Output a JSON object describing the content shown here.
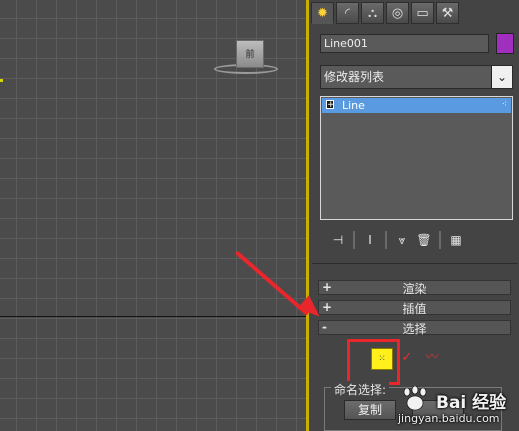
{
  "viewport": {
    "viewcube_label": "前",
    "border_color": "#c8b000"
  },
  "tabs": [
    {
      "name": "create-tab",
      "icon": "sun-icon",
      "glyph": "✹"
    },
    {
      "name": "modify-tab",
      "icon": "modify-arc-icon",
      "glyph": "◜"
    },
    {
      "name": "hierarchy-tab",
      "icon": "hierarchy-icon",
      "glyph": "⛬"
    },
    {
      "name": "motion-tab",
      "icon": "motion-icon",
      "glyph": "◎"
    },
    {
      "name": "display-tab",
      "icon": "monitor-icon",
      "glyph": "▭"
    },
    {
      "name": "utilities-tab",
      "icon": "hammer-icon",
      "glyph": "⚒"
    }
  ],
  "object": {
    "name": "Line001",
    "color": "#a02ebe"
  },
  "modifier_list": {
    "selected": "修改器列表"
  },
  "stack": {
    "items": [
      {
        "label": "Line",
        "expand": "+"
      }
    ]
  },
  "stack_tools": [
    {
      "name": "pin-stack-icon",
      "glyph": "⊣"
    },
    {
      "name": "show-end-result-icon",
      "glyph": "Ⅰ"
    },
    {
      "name": "make-unique-icon",
      "glyph": "⩔"
    },
    {
      "name": "remove-modifier-icon",
      "glyph": "🗑"
    },
    {
      "name": "configure-sets-icon",
      "glyph": "▦"
    }
  ],
  "rollouts": [
    {
      "sign": "+",
      "title": "渲染"
    },
    {
      "sign": "+",
      "title": "插值"
    },
    {
      "sign": "-",
      "title": "选择"
    }
  ],
  "selection": {
    "vertex_glyph": "⁙",
    "segment_glyph": "✓",
    "spline_glyph": "〰",
    "named_label": "命名选择:",
    "copy_label": "复制"
  },
  "annotation": {
    "arrow_color": "#e8262c"
  },
  "watermark": {
    "title": "Bai 经验",
    "url": "jingyan.baidu.com"
  }
}
